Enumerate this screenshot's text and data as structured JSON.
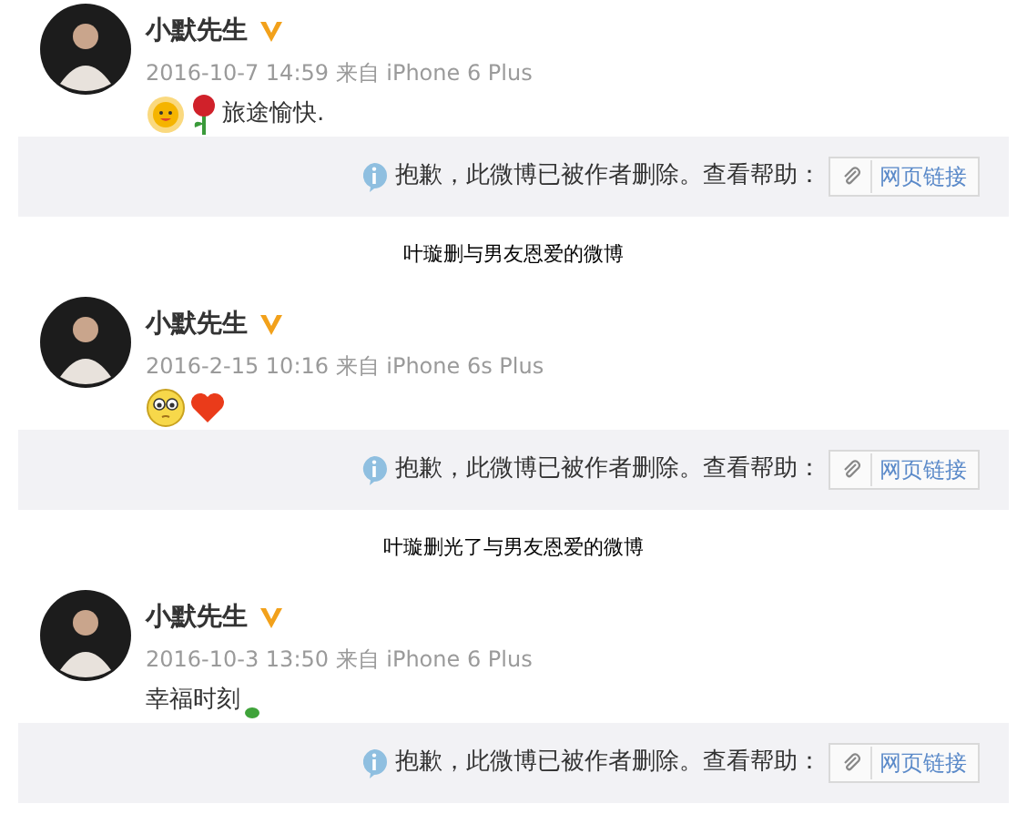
{
  "posts": [
    {
      "author": "小默先生",
      "verified": true,
      "meta": "2016-10-7 14:59 来自 iPhone 6 Plus",
      "content": [
        {
          "kind": "sun"
        },
        {
          "kind": "rose"
        },
        {
          "kind": "text",
          "text": "旅途愉快."
        }
      ],
      "notice": {
        "message": "抱歉，此微博已被作者删除。查看帮助：",
        "link": "网页链接"
      },
      "caption": "叶璇删与男友恩爱的微博"
    },
    {
      "author": "小默先生",
      "verified": true,
      "meta": "2016-2-15 10:16 来自 iPhone 6s Plus",
      "content": [
        {
          "kind": "shy"
        },
        {
          "kind": "heart"
        }
      ],
      "notice": {
        "message": "抱歉，此微博已被作者删除。查看帮助：",
        "link": "网页链接"
      },
      "caption": "叶璇删光了与男友恩爱的微博"
    },
    {
      "author": "小默先生",
      "verified": true,
      "meta": "2016-10-3 13:50 来自 iPhone 6 Plus",
      "content": [
        {
          "kind": "text",
          "text": "幸福时刻"
        },
        {
          "kind": "leaf"
        }
      ],
      "notice": {
        "message": "抱歉，此微博已被作者删除。查看帮助：",
        "link": "网页链接"
      }
    }
  ]
}
